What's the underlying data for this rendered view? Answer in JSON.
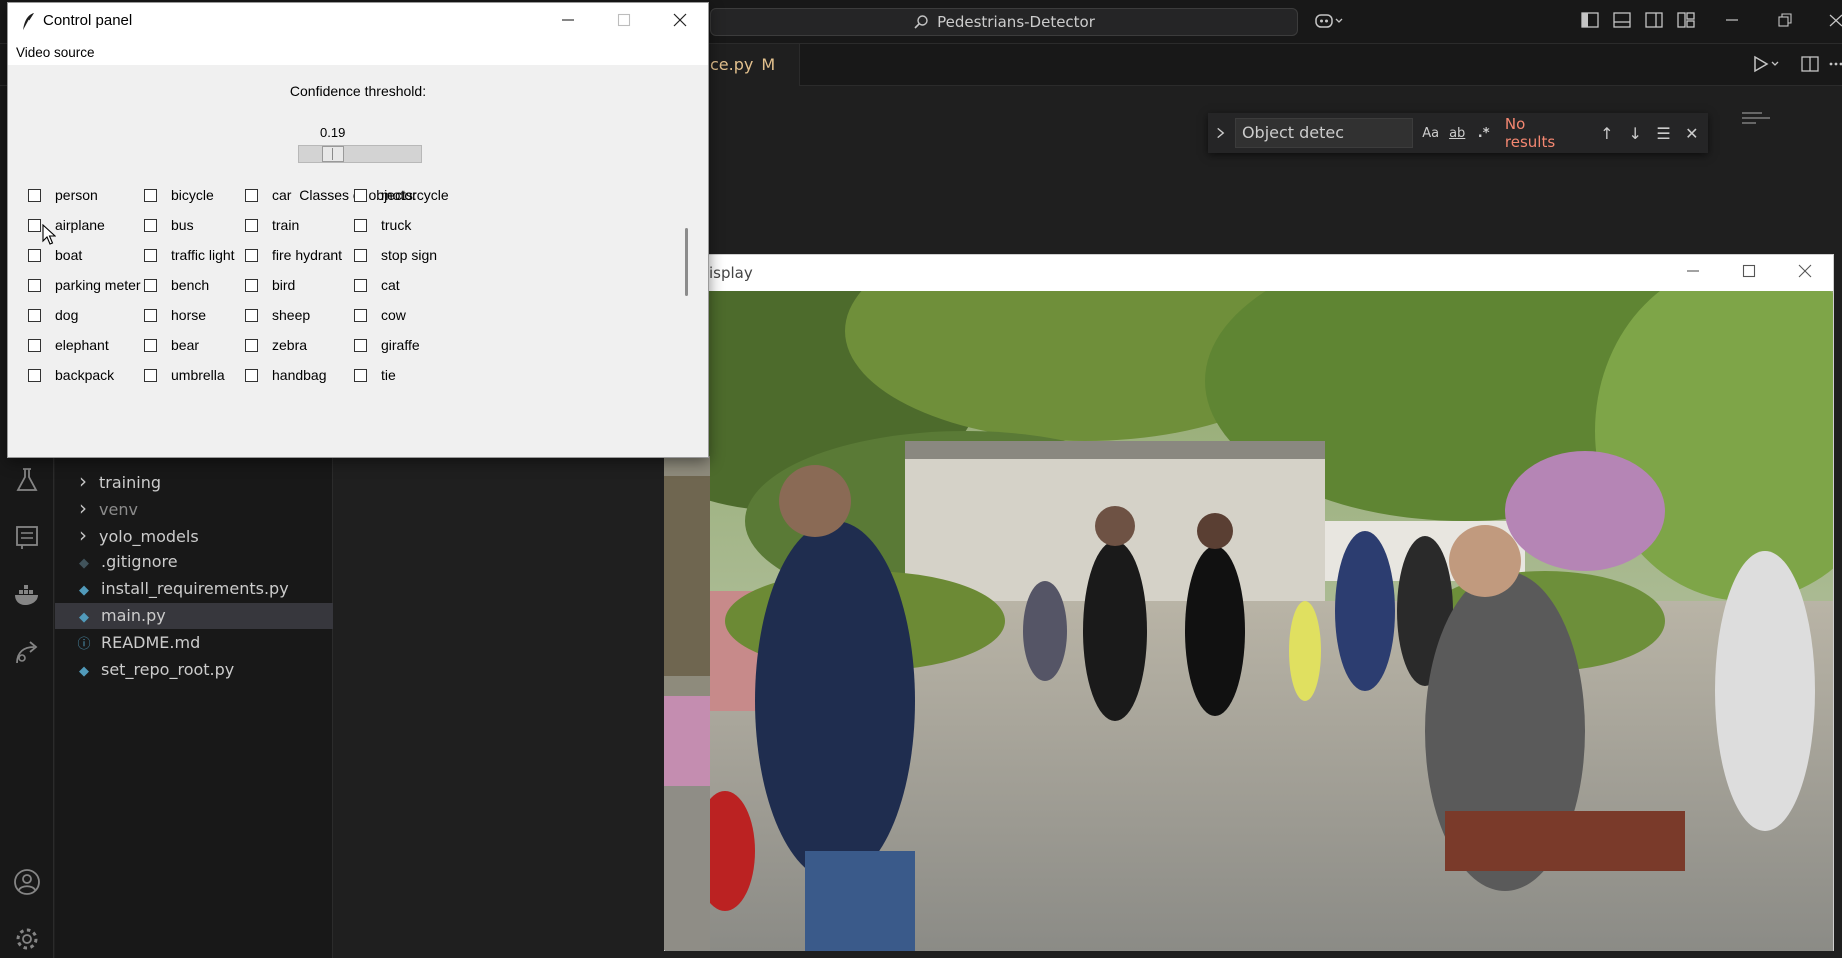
{
  "vscode": {
    "command_center": "Pedestrians-Detector",
    "editor_tab": {
      "label": "ce.py",
      "modified": "M"
    },
    "find_widget": {
      "query": "Object detec",
      "match_case": "Aa",
      "whole_word": "ab",
      "regex": ".*",
      "status": "No results"
    },
    "explorer": {
      "items": [
        {
          "label": "training",
          "type": "folder",
          "expanded": false
        },
        {
          "label": "venv",
          "type": "folder",
          "expanded": false,
          "dim": true
        },
        {
          "label": "yolo_models",
          "type": "folder",
          "expanded": false
        },
        {
          "label": ".gitignore",
          "type": "file",
          "icon": "gitignore-icon"
        },
        {
          "label": "install_requirements.py",
          "type": "file",
          "icon": "python-icon"
        },
        {
          "label": "main.py",
          "type": "file",
          "icon": "python-icon",
          "selected": true
        },
        {
          "label": "README.md",
          "type": "file",
          "icon": "info-icon"
        },
        {
          "label": "set_repo_root.py",
          "type": "file",
          "icon": "python-icon"
        }
      ]
    }
  },
  "display_window": {
    "title": "isplay"
  },
  "control_panel": {
    "title": "Control panel",
    "menu": {
      "video_source": "Video source"
    },
    "confidence": {
      "label": "Confidence threshold:",
      "value": "0.19",
      "fraction": 0.19
    },
    "classes_label": "Classes of objects:",
    "classes": [
      [
        "person",
        "bicycle",
        "car",
        "motorcycle"
      ],
      [
        "airplane",
        "bus",
        "train",
        "truck"
      ],
      [
        "boat",
        "traffic light",
        "fire hydrant",
        "stop sign"
      ],
      [
        "parking meter",
        "bench",
        "bird",
        "cat"
      ],
      [
        "dog",
        "horse",
        "sheep",
        "cow"
      ],
      [
        "elephant",
        "bear",
        "zebra",
        "giraffe"
      ],
      [
        "backpack",
        "umbrella",
        "handbag",
        "tie"
      ]
    ]
  },
  "colors": {
    "vscode_bg": "#1f1f1f",
    "no_results": "#f48771",
    "modified": "#e2c08d",
    "python_icon": "#519aba"
  }
}
